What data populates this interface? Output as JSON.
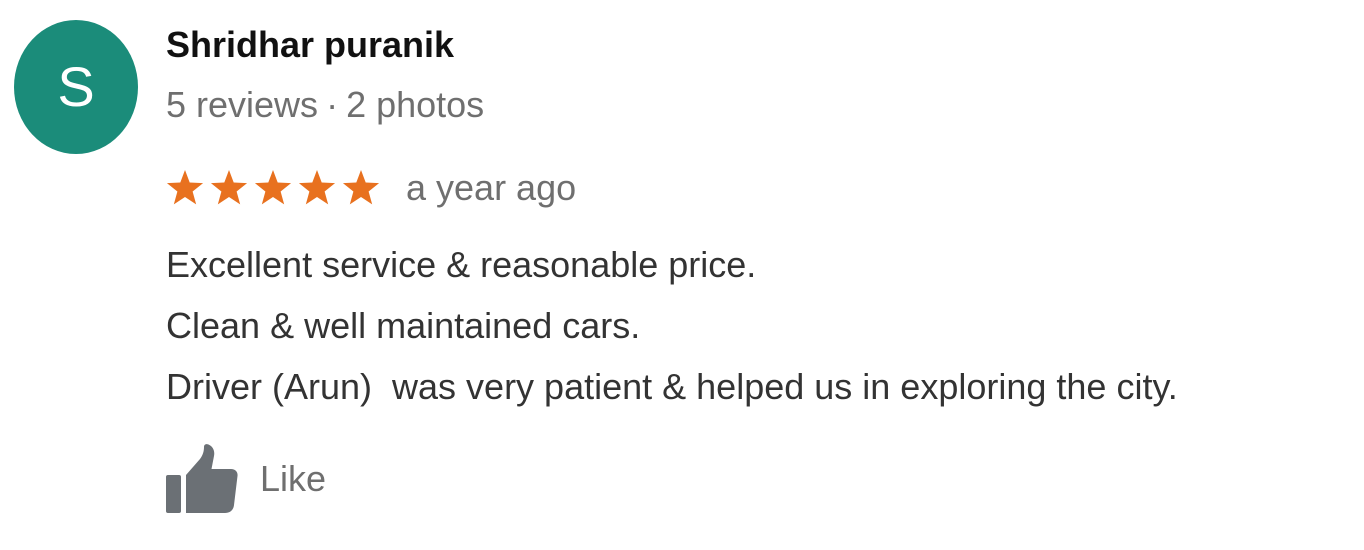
{
  "review": {
    "author": {
      "initial": "S",
      "name": "Shridhar puranik",
      "reviews": "5 reviews",
      "separator": "·",
      "photos": "2 photos",
      "avatar_color": "#1b8c7a"
    },
    "rating": {
      "stars": 5,
      "max_stars": 5,
      "star_color": "#e8711f",
      "icon": "star-icon"
    },
    "time_ago": "a year ago",
    "body_lines": [
      "Excellent service & reasonable price.",
      "Clean & well maintained cars.",
      "Driver (Arun)  was very patient & helped us in exploring the city."
    ],
    "like": {
      "label": "Like",
      "icon": "thumbs-up-icon",
      "icon_color": "#6b7075"
    }
  }
}
